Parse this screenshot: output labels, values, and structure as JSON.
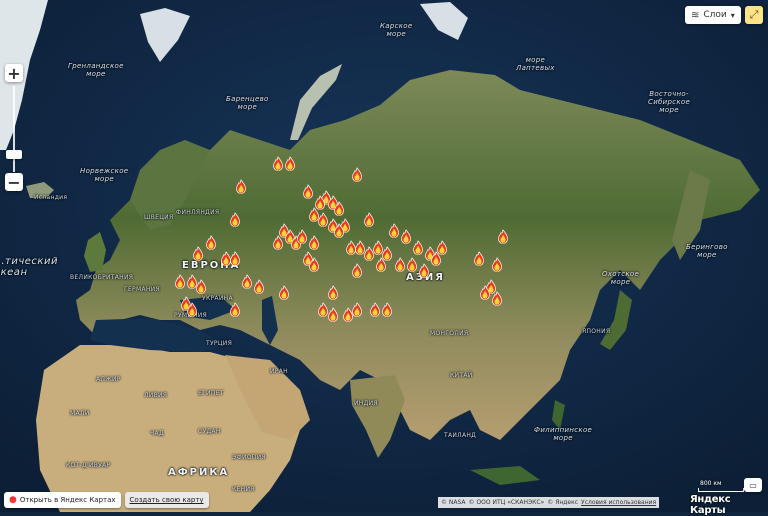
{
  "controls": {
    "layers_label": "Слои",
    "open_in_yandex": "Открыть в Яндекс Картах",
    "create_map": "Создать свою карту",
    "scale_label": "800 км",
    "attribution": [
      "© NASA",
      "© ООО ИТЦ «СКАНЭКС»",
      "© Яндекс"
    ],
    "terms_link": "Условия использования",
    "logo": "Яндекс Карты"
  },
  "labels": {
    "continents": [
      "ЕВРОПА",
      "АЗИЯ",
      "АФРИКА"
    ],
    "seas": [
      "Карское\nморе",
      "Гренландское\nморе",
      "море\nЛаптевых",
      "Баренцево\nморе",
      "Восточно-\nСибирское\nморе",
      "Норвежское\nморе",
      "Берингово\nморе",
      "Охотское\nморе",
      "Филиппинское\nморе"
    ],
    "ocean": "...тический\nокеан",
    "countries": [
      "Исландия",
      "ФИНЛЯНДИЯ",
      "ШВЕЦИЯ",
      "ВЕЛИКОБРИТАНИЯ",
      "ГЕРМАНИЯ",
      "УКРАИНА",
      "РУМЫНИЯ",
      "ТУРЦИЯ",
      "МОНГОЛИЯ",
      "КИТАЙ",
      "ИРАН",
      "ЕГИПЕТ",
      "ЛИВИЯ",
      "КОТ-Д'ИВУАР",
      "ЧАД",
      "СУДАН",
      "ЭФИОПИЯ",
      "КЕНИЯ",
      "ТАИЛАНД",
      "ИНДИЯ",
      "ЯПОНИЯ",
      "МАЛИ",
      "АЛЖИР"
    ]
  },
  "fires": [
    {
      "lon": 62,
      "lat": 68
    },
    {
      "lon": 66,
      "lat": 68
    },
    {
      "lon": 50,
      "lat": 64
    },
    {
      "lon": 88,
      "lat": 66
    },
    {
      "lon": 72,
      "lat": 63
    },
    {
      "lon": 78,
      "lat": 62
    },
    {
      "lon": 80,
      "lat": 61
    },
    {
      "lon": 76,
      "lat": 61
    },
    {
      "lon": 82,
      "lat": 60
    },
    {
      "lon": 74,
      "lat": 59
    },
    {
      "lon": 77,
      "lat": 58
    },
    {
      "lon": 80,
      "lat": 57
    },
    {
      "lon": 84,
      "lat": 57
    },
    {
      "lon": 82,
      "lat": 56
    },
    {
      "lon": 92,
      "lat": 58
    },
    {
      "lon": 100,
      "lat": 56
    },
    {
      "lon": 104,
      "lat": 55
    },
    {
      "lon": 64,
      "lat": 56
    },
    {
      "lon": 66,
      "lat": 55
    },
    {
      "lon": 62,
      "lat": 54
    },
    {
      "lon": 68,
      "lat": 54
    },
    {
      "lon": 70,
      "lat": 55
    },
    {
      "lon": 74,
      "lat": 54
    },
    {
      "lon": 86,
      "lat": 53
    },
    {
      "lon": 89,
      "lat": 53
    },
    {
      "lon": 92,
      "lat": 52
    },
    {
      "lon": 95,
      "lat": 53
    },
    {
      "lon": 98,
      "lat": 52
    },
    {
      "lon": 108,
      "lat": 53
    },
    {
      "lon": 112,
      "lat": 52
    },
    {
      "lon": 116,
      "lat": 53
    },
    {
      "lon": 114,
      "lat": 51
    },
    {
      "lon": 96,
      "lat": 50
    },
    {
      "lon": 102,
      "lat": 50
    },
    {
      "lon": 106,
      "lat": 50
    },
    {
      "lon": 110,
      "lat": 49
    },
    {
      "lon": 72,
      "lat": 51
    },
    {
      "lon": 74,
      "lat": 50
    },
    {
      "lon": 88,
      "lat": 49
    },
    {
      "lon": 48,
      "lat": 58
    },
    {
      "lon": 40,
      "lat": 54
    },
    {
      "lon": 36,
      "lat": 52
    },
    {
      "lon": 45,
      "lat": 51
    },
    {
      "lon": 48,
      "lat": 51
    },
    {
      "lon": 136,
      "lat": 55
    },
    {
      "lon": 128,
      "lat": 51
    },
    {
      "lon": 134,
      "lat": 50
    },
    {
      "lon": 132,
      "lat": 46
    },
    {
      "lon": 130,
      "lat": 45
    },
    {
      "lon": 134,
      "lat": 44
    },
    {
      "lon": 30,
      "lat": 47
    },
    {
      "lon": 34,
      "lat": 47
    },
    {
      "lon": 37,
      "lat": 46
    },
    {
      "lon": 52,
      "lat": 47
    },
    {
      "lon": 56,
      "lat": 46
    },
    {
      "lon": 64,
      "lat": 45
    },
    {
      "lon": 80,
      "lat": 45
    },
    {
      "lon": 32,
      "lat": 43
    },
    {
      "lon": 34,
      "lat": 42
    },
    {
      "lon": 48,
      "lat": 42
    },
    {
      "lon": 77,
      "lat": 42
    },
    {
      "lon": 80,
      "lat": 41
    },
    {
      "lon": 85,
      "lat": 41
    },
    {
      "lon": 88,
      "lat": 42
    },
    {
      "lon": 94,
      "lat": 42
    },
    {
      "lon": 98,
      "lat": 42
    }
  ],
  "colors": {
    "ocean": "#10263f",
    "land_forest": "#3d5a2c",
    "land_tundra": "#6e7b4a",
    "land_desert": "#c8ad7c",
    "ice": "#e8eef2",
    "fire_outer": "#e53b1d",
    "fire_inner": "#ffd23c",
    "fullscreen_button": "#ffe38a"
  }
}
